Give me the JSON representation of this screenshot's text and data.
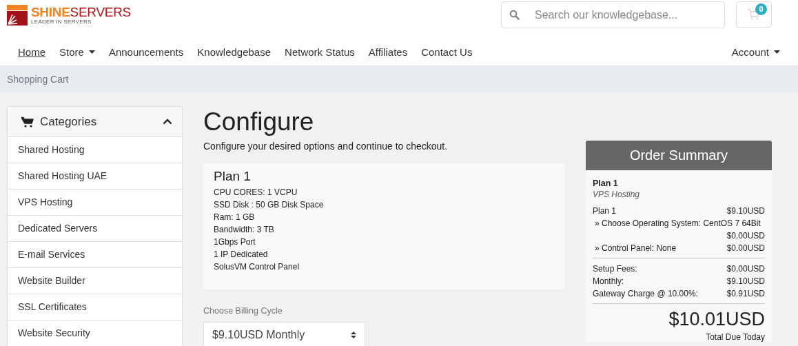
{
  "header": {
    "logo": {
      "name_parts": [
        "SHINE",
        "SERVERS"
      ],
      "tagline": "LEADER IN SERVERS"
    },
    "search": {
      "placeholder": "Search our knowledgebase..."
    },
    "cart": {
      "count": "0"
    }
  },
  "nav": {
    "items": [
      {
        "label": "Home",
        "selected": true,
        "dropdown": false
      },
      {
        "label": "Store",
        "selected": false,
        "dropdown": true
      },
      {
        "label": "Announcements",
        "selected": false,
        "dropdown": false
      },
      {
        "label": "Knowledgebase",
        "selected": false,
        "dropdown": false
      },
      {
        "label": "Network Status",
        "selected": false,
        "dropdown": false
      },
      {
        "label": "Affiliates",
        "selected": false,
        "dropdown": false
      },
      {
        "label": "Contact Us",
        "selected": false,
        "dropdown": false
      }
    ],
    "account": {
      "label": "Account",
      "dropdown": true
    }
  },
  "breadcrumb": "Shopping Cart",
  "sidebar": {
    "title": "Categories",
    "expanded": true,
    "items": [
      {
        "label": "Shared Hosting",
        "selected": false
      },
      {
        "label": "Shared Hosting UAE",
        "selected": false
      },
      {
        "label": "VPS Hosting",
        "selected": false
      },
      {
        "label": "Dedicated Servers",
        "selected": false
      },
      {
        "label": "E-mail Services",
        "selected": false
      },
      {
        "label": "Website Builder",
        "selected": false
      },
      {
        "label": "SSL Certificates",
        "selected": false
      },
      {
        "label": "Website Security",
        "selected": false
      }
    ]
  },
  "main": {
    "title": "Configure",
    "subtitle": "Configure your desired options and continue to checkout.",
    "plan": {
      "name": "Plan 1",
      "features": [
        "CPU CORES: 1 VCPU",
        "SSD Disk : 50 GB Disk Space",
        "Ram: 1 GB",
        "Bandwidth: 3 TB",
        "1Gbps Port",
        "1 IP Dedicated",
        "SolusVM Control Panel"
      ]
    },
    "billing": {
      "label": "Choose Billing Cycle",
      "value": "$9.10USD Monthly"
    }
  },
  "summary": {
    "title": "Order Summary",
    "product": "Plan 1",
    "group": "VPS Hosting",
    "items": [
      {
        "kind": "base",
        "label": "Plan 1",
        "price": "$9.10USD"
      },
      {
        "kind": "option",
        "label": "» Choose Operating System: CentOS 7 64Bit",
        "price": "$0.00USD"
      },
      {
        "kind": "option",
        "label": "» Control Panel: None",
        "price": "$0.00USD"
      }
    ],
    "fees": [
      {
        "label": "Setup Fees:",
        "price": "$0.00USD"
      },
      {
        "label": "Monthly:",
        "price": "$9.10USD"
      },
      {
        "label": "Gateway Charge @ 10.00%:",
        "price": "$0.91USD"
      }
    ],
    "total": "$10.01USD",
    "total_label": "Total Due Today"
  }
}
